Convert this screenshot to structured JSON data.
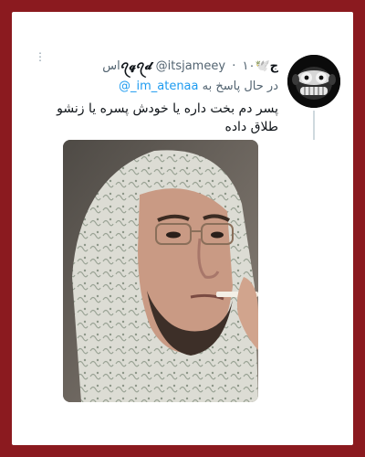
{
  "tweet": {
    "display_name": "ج🕊️ꪖ𝓺ꪖ𝓭",
    "handle": "@itsjameey",
    "separator": "·",
    "time": "۱۰اس",
    "reply_prefix": "در حال پاسخ به",
    "reply_to": "@_im_atenaa",
    "text": "پسر دم بخت داره یا خودش پسره یا زنشو طلاق داده"
  },
  "icons": {
    "more": "more-vertical-icon",
    "avatar": "monkey-avatar"
  },
  "colors": {
    "frame": "#8b1a1f",
    "link": "#1d9bf0",
    "muted": "#536471"
  }
}
